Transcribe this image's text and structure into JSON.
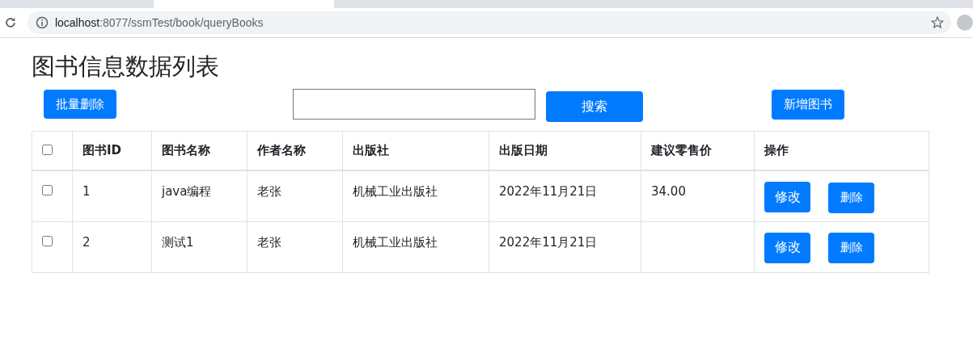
{
  "browser": {
    "url_host": "localhost",
    "url_path": ":8077/ssmTest/book/queryBooks"
  },
  "page": {
    "title": "图书信息数据列表",
    "toolbar": {
      "batch_delete": "批量删除",
      "search_button": "搜索",
      "add_button": "新增图书"
    },
    "table": {
      "select_all": {
        "checked": false
      },
      "columns": [
        "图书ID",
        "图书名称",
        "作者名称",
        "出版社",
        "出版日期",
        "建议零售价",
        "操作"
      ],
      "rows": [
        {
          "checked": false,
          "cells": [
            "1",
            "java编程",
            "老张",
            "机械工业出版社",
            "2022年11月21日",
            "34.00"
          ],
          "actions": [
            "修改",
            "删除"
          ]
        },
        {
          "checked": false,
          "cells": [
            "2",
            "测试1",
            "老张",
            "机械工业出版社",
            "2022年11月21日",
            null
          ],
          "actions": [
            "修改",
            "删除"
          ]
        }
      ]
    }
  }
}
